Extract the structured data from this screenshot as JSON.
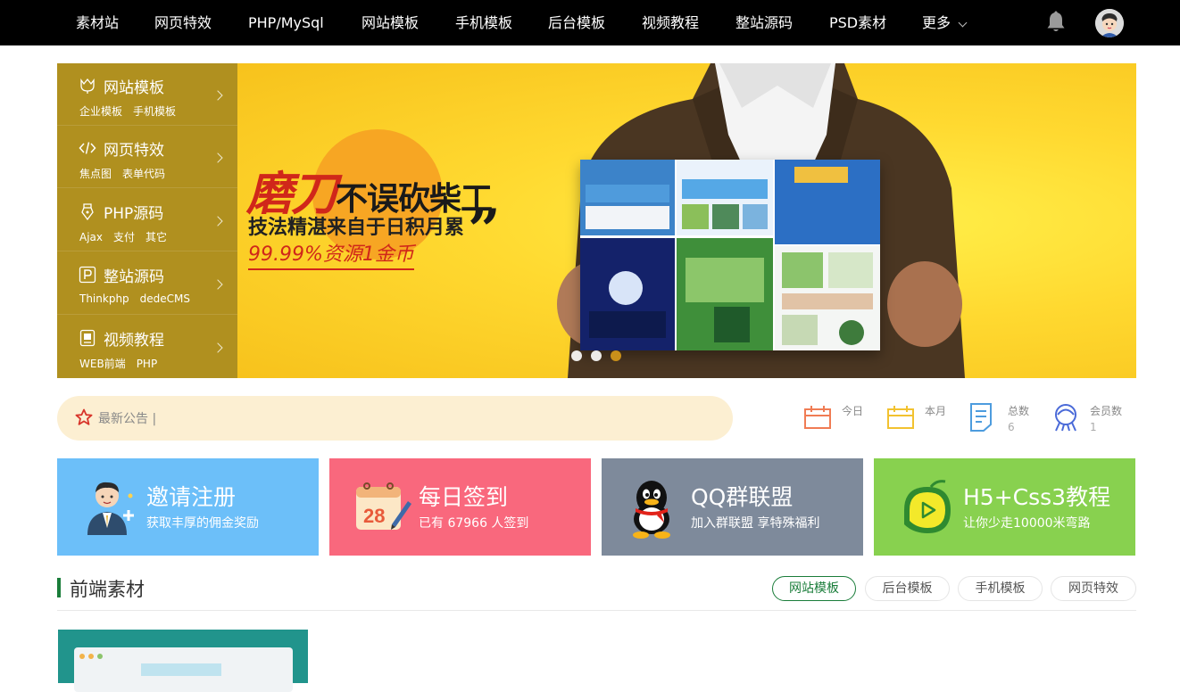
{
  "nav": {
    "items": [
      "素材站",
      "网页特效",
      "PHP/MySql",
      "网站模板",
      "手机模板",
      "后台模板",
      "视频教程",
      "整站源码",
      "PSD素材",
      "更多"
    ]
  },
  "sidemenu": [
    {
      "title": "网站模板",
      "subs": [
        "企业模板",
        "手机模板"
      ],
      "icon": "tulip-icon"
    },
    {
      "title": "网页特效",
      "subs": [
        "焦点图",
        "表单代码"
      ],
      "icon": "code-icon"
    },
    {
      "title": "PHP源码",
      "subs": [
        "Ajax",
        "支付",
        "其它"
      ],
      "icon": "pen-nib-icon"
    },
    {
      "title": "整站源码",
      "subs": [
        "Thinkphp",
        "dedeCMS"
      ],
      "icon": "parking-p-icon"
    },
    {
      "title": "视频教程",
      "subs": [
        "WEB前端",
        "PHP"
      ],
      "icon": "video-book-icon"
    }
  ],
  "banner": {
    "headline_big": "磨刀",
    "headline_rest": "不误砍柴工",
    "tagline": "技法精湛来自于日积月累",
    "promo_percent": "99.99%",
    "promo_rest": "资源1金币",
    "active_slide": 3,
    "slide_count": 3
  },
  "notice": {
    "label": "最新公告 |"
  },
  "stats": [
    {
      "label": "今日",
      "value": "",
      "icon": "calendar-today-icon",
      "color": "#f07c54"
    },
    {
      "label": "本月",
      "value": "",
      "icon": "calendar-month-icon",
      "color": "#f2c230"
    },
    {
      "label": "总数",
      "value": "6",
      "icon": "document-icon",
      "color": "#4d9cde"
    },
    {
      "label": "会员数",
      "value": "1",
      "icon": "members-icon",
      "color": "#4a6ad8"
    }
  ],
  "cards": [
    {
      "title": "邀请注册",
      "sub": "获取丰厚的佣金奖励",
      "color": "#6cbff9",
      "icon": "invite-user-icon"
    },
    {
      "title": "每日签到",
      "sub": "已有 67966 人签到",
      "color": "#f9687d",
      "icon": "calendar-checkin-icon"
    },
    {
      "title": "QQ群联盟",
      "sub": "加入群联盟 享特殊福利",
      "color": "#7e8a9b",
      "icon": "qq-penguin-icon"
    },
    {
      "title": "H5+Css3教程",
      "sub": "让你少走10000米弯路",
      "color": "#88d14f",
      "icon": "play-bubble-icon"
    }
  ],
  "section": {
    "title": "前端素材",
    "tabs": [
      "网站模板",
      "后台模板",
      "手机模板",
      "网页特效"
    ],
    "active_tab": 0
  }
}
